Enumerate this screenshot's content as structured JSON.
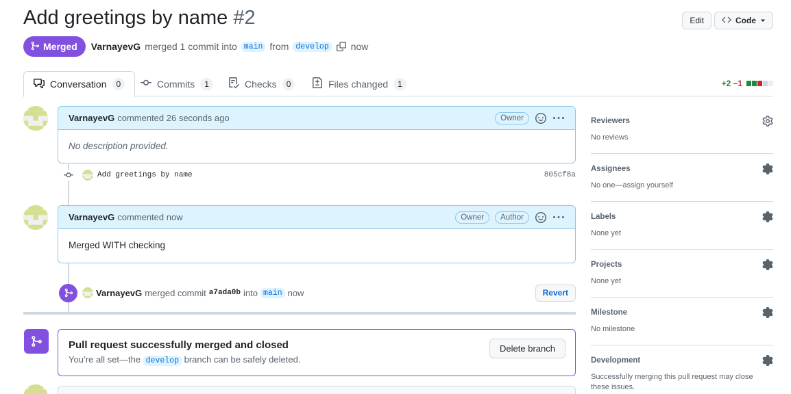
{
  "pr": {
    "title": "Add greetings by name",
    "number": "#2",
    "state_label": "Merged",
    "author": "VarnayevG",
    "summary_mid": "merged 1 commit into",
    "base_branch": "main",
    "from_word": "from",
    "head_branch": "develop",
    "time": "now"
  },
  "header": {
    "edit_label": "Edit",
    "code_label": "Code"
  },
  "tabs": [
    {
      "label": "Conversation",
      "count": "0"
    },
    {
      "label": "Commits",
      "count": "1"
    },
    {
      "label": "Checks",
      "count": "0"
    },
    {
      "label": "Files changed",
      "count": "1"
    }
  ],
  "diffstat": {
    "additions": "+2",
    "deletions": "−1"
  },
  "timeline": {
    "comment1": {
      "author": "VarnayevG",
      "action": "commented 26 seconds ago",
      "badge_owner": "Owner",
      "body": "No description provided."
    },
    "commit": {
      "message": "Add greetings by name",
      "sha": "805cf8a"
    },
    "comment2": {
      "author": "VarnayevG",
      "action": "commented now",
      "badge_owner": "Owner",
      "badge_author": "Author",
      "body": "Merged WITH checking"
    },
    "merge_event": {
      "author": "VarnayevG",
      "text1": "merged commit",
      "sha": "a7ada0b",
      "text2": "into",
      "branch": "main",
      "time": "now",
      "revert_label": "Revert"
    },
    "merged_box": {
      "title": "Pull request successfully merged and closed",
      "sub_prefix": "You’re all set—the",
      "branch": "develop",
      "sub_suffix": "branch can be safely deleted.",
      "delete_label": "Delete branch"
    }
  },
  "sidebar": {
    "reviewers": {
      "title": "Reviewers",
      "value": "No reviews"
    },
    "assignees": {
      "title": "Assignees",
      "value": "No one—assign yourself"
    },
    "labels": {
      "title": "Labels",
      "value": "None yet"
    },
    "projects": {
      "title": "Projects",
      "value": "None yet"
    },
    "milestone": {
      "title": "Milestone",
      "value": "No milestone"
    },
    "development": {
      "title": "Development",
      "value": "Successfully merging this pull request may close these issues."
    }
  },
  "colors": {
    "merged": "#8250df",
    "addition": "#1a7f37",
    "deletion": "#d1242f",
    "link": "#0969da"
  }
}
